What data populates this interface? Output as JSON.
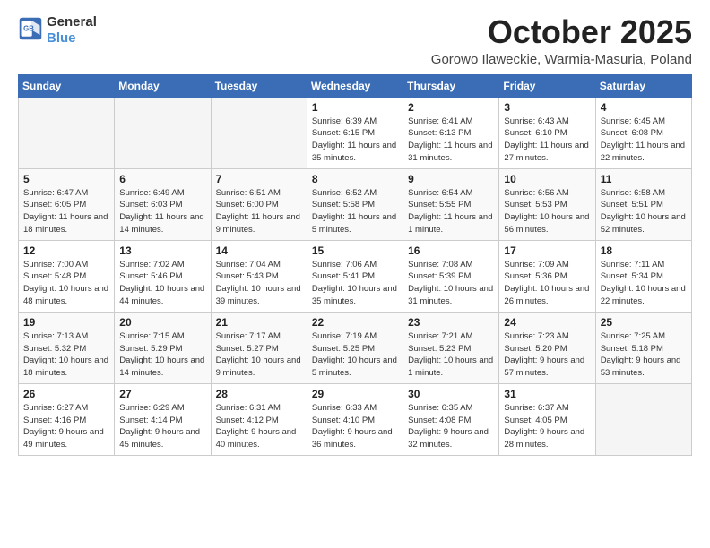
{
  "header": {
    "logo_general": "General",
    "logo_blue": "Blue",
    "title": "October 2025",
    "subtitle": "Gorowo Ilaweckie, Warmia-Masuria, Poland"
  },
  "days_of_week": [
    "Sunday",
    "Monday",
    "Tuesday",
    "Wednesday",
    "Thursday",
    "Friday",
    "Saturday"
  ],
  "weeks": [
    [
      {
        "day": "",
        "empty": true
      },
      {
        "day": "",
        "empty": true
      },
      {
        "day": "",
        "empty": true
      },
      {
        "day": "1",
        "sunrise": "6:39 AM",
        "sunset": "6:15 PM",
        "daylight": "11 hours and 35 minutes."
      },
      {
        "day": "2",
        "sunrise": "6:41 AM",
        "sunset": "6:13 PM",
        "daylight": "11 hours and 31 minutes."
      },
      {
        "day": "3",
        "sunrise": "6:43 AM",
        "sunset": "6:10 PM",
        "daylight": "11 hours and 27 minutes."
      },
      {
        "day": "4",
        "sunrise": "6:45 AM",
        "sunset": "6:08 PM",
        "daylight": "11 hours and 22 minutes."
      }
    ],
    [
      {
        "day": "5",
        "sunrise": "6:47 AM",
        "sunset": "6:05 PM",
        "daylight": "11 hours and 18 minutes."
      },
      {
        "day": "6",
        "sunrise": "6:49 AM",
        "sunset": "6:03 PM",
        "daylight": "11 hours and 14 minutes."
      },
      {
        "day": "7",
        "sunrise": "6:51 AM",
        "sunset": "6:00 PM",
        "daylight": "11 hours and 9 minutes."
      },
      {
        "day": "8",
        "sunrise": "6:52 AM",
        "sunset": "5:58 PM",
        "daylight": "11 hours and 5 minutes."
      },
      {
        "day": "9",
        "sunrise": "6:54 AM",
        "sunset": "5:55 PM",
        "daylight": "11 hours and 1 minute."
      },
      {
        "day": "10",
        "sunrise": "6:56 AM",
        "sunset": "5:53 PM",
        "daylight": "10 hours and 56 minutes."
      },
      {
        "day": "11",
        "sunrise": "6:58 AM",
        "sunset": "5:51 PM",
        "daylight": "10 hours and 52 minutes."
      }
    ],
    [
      {
        "day": "12",
        "sunrise": "7:00 AM",
        "sunset": "5:48 PM",
        "daylight": "10 hours and 48 minutes."
      },
      {
        "day": "13",
        "sunrise": "7:02 AM",
        "sunset": "5:46 PM",
        "daylight": "10 hours and 44 minutes."
      },
      {
        "day": "14",
        "sunrise": "7:04 AM",
        "sunset": "5:43 PM",
        "daylight": "10 hours and 39 minutes."
      },
      {
        "day": "15",
        "sunrise": "7:06 AM",
        "sunset": "5:41 PM",
        "daylight": "10 hours and 35 minutes."
      },
      {
        "day": "16",
        "sunrise": "7:08 AM",
        "sunset": "5:39 PM",
        "daylight": "10 hours and 31 minutes."
      },
      {
        "day": "17",
        "sunrise": "7:09 AM",
        "sunset": "5:36 PM",
        "daylight": "10 hours and 26 minutes."
      },
      {
        "day": "18",
        "sunrise": "7:11 AM",
        "sunset": "5:34 PM",
        "daylight": "10 hours and 22 minutes."
      }
    ],
    [
      {
        "day": "19",
        "sunrise": "7:13 AM",
        "sunset": "5:32 PM",
        "daylight": "10 hours and 18 minutes."
      },
      {
        "day": "20",
        "sunrise": "7:15 AM",
        "sunset": "5:29 PM",
        "daylight": "10 hours and 14 minutes."
      },
      {
        "day": "21",
        "sunrise": "7:17 AM",
        "sunset": "5:27 PM",
        "daylight": "10 hours and 9 minutes."
      },
      {
        "day": "22",
        "sunrise": "7:19 AM",
        "sunset": "5:25 PM",
        "daylight": "10 hours and 5 minutes."
      },
      {
        "day": "23",
        "sunrise": "7:21 AM",
        "sunset": "5:23 PM",
        "daylight": "10 hours and 1 minute."
      },
      {
        "day": "24",
        "sunrise": "7:23 AM",
        "sunset": "5:20 PM",
        "daylight": "9 hours and 57 minutes."
      },
      {
        "day": "25",
        "sunrise": "7:25 AM",
        "sunset": "5:18 PM",
        "daylight": "9 hours and 53 minutes."
      }
    ],
    [
      {
        "day": "26",
        "sunrise": "6:27 AM",
        "sunset": "4:16 PM",
        "daylight": "9 hours and 49 minutes."
      },
      {
        "day": "27",
        "sunrise": "6:29 AM",
        "sunset": "4:14 PM",
        "daylight": "9 hours and 45 minutes."
      },
      {
        "day": "28",
        "sunrise": "6:31 AM",
        "sunset": "4:12 PM",
        "daylight": "9 hours and 40 minutes."
      },
      {
        "day": "29",
        "sunrise": "6:33 AM",
        "sunset": "4:10 PM",
        "daylight": "9 hours and 36 minutes."
      },
      {
        "day": "30",
        "sunrise": "6:35 AM",
        "sunset": "4:08 PM",
        "daylight": "9 hours and 32 minutes."
      },
      {
        "day": "31",
        "sunrise": "6:37 AM",
        "sunset": "4:05 PM",
        "daylight": "9 hours and 28 minutes."
      },
      {
        "day": "",
        "empty": true
      }
    ]
  ]
}
